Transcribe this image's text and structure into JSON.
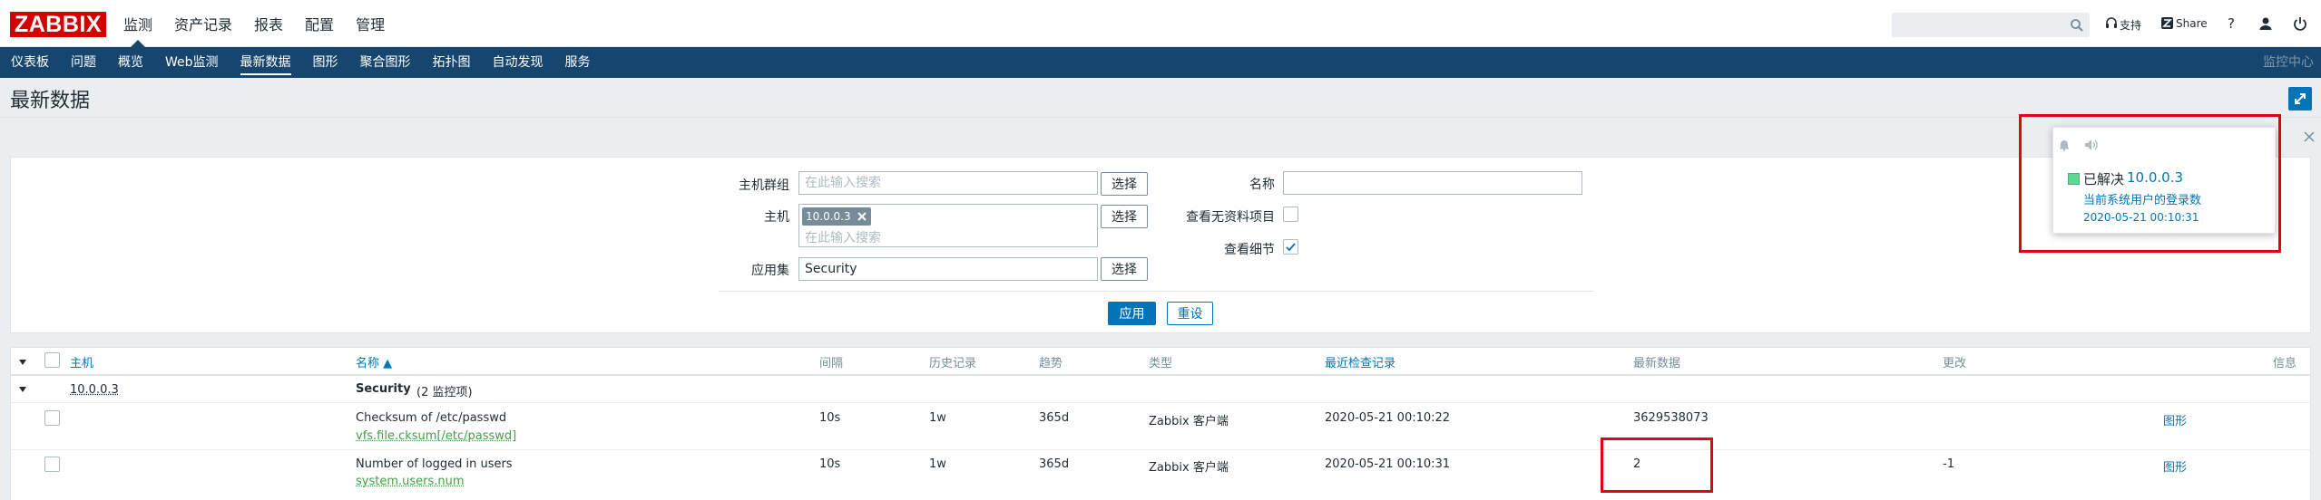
{
  "header": {
    "logo": "ZABBIX",
    "menu": [
      {
        "label": "监测",
        "selected": true
      },
      {
        "label": "资产记录",
        "selected": false
      },
      {
        "label": "报表",
        "selected": false
      },
      {
        "label": "配置",
        "selected": false
      },
      {
        "label": "管理",
        "selected": false
      }
    ],
    "search_value": "",
    "support_label": "支持",
    "share_label": "Share",
    "help_label": "?"
  },
  "subnav": {
    "items": [
      {
        "label": "仪表板",
        "selected": false
      },
      {
        "label": "问题",
        "selected": false
      },
      {
        "label": "概览",
        "selected": false
      },
      {
        "label": "Web监测",
        "selected": false
      },
      {
        "label": "最新数据",
        "selected": true
      },
      {
        "label": "图形",
        "selected": false
      },
      {
        "label": "聚合图形",
        "selected": false
      },
      {
        "label": "拓扑图",
        "selected": false
      },
      {
        "label": "自动发现",
        "selected": false
      },
      {
        "label": "服务",
        "selected": false
      }
    ],
    "right_label": "监控中心"
  },
  "page": {
    "title": "最新数据"
  },
  "filter": {
    "host_group_label": "主机群组",
    "host_group_placeholder": "在此输入搜索",
    "select_label": "选择",
    "host_label": "主机",
    "host_chip": "10.0.0.3",
    "host_placeholder": "在此输入搜索",
    "application_label": "应用集",
    "application_value": "Security",
    "name_label": "名称",
    "name_value": "",
    "show_without_data_label": "查看无资料项目",
    "show_without_data_checked": false,
    "show_details_label": "查看细节",
    "show_details_checked": true,
    "apply_label": "应用",
    "reset_label": "重设"
  },
  "table": {
    "headers": {
      "host": "主机",
      "name": "名称 ▲",
      "interval": "间隔",
      "history": "历史记录",
      "trends": "趋势",
      "type": "类型",
      "last_check": "最近检查记录",
      "last_value": "最新数据",
      "change": "更改",
      "info": "信息"
    },
    "group": {
      "host": "10.0.0.3",
      "app": "Security",
      "count": "(2 监控项)"
    },
    "rows": [
      {
        "name": "Checksum of /etc/passwd",
        "key": "vfs.file.cksum[/etc/passwd]",
        "interval": "10s",
        "history": "1w",
        "trends": "365d",
        "type": "Zabbix 客户端",
        "last_check": "2020-05-21 00:10:22",
        "last_value": "3629538073",
        "change": "",
        "graph": "图形"
      },
      {
        "name": "Number of logged in users",
        "key": "system.users.num",
        "interval": "10s",
        "history": "1w",
        "trends": "365d",
        "type": "Zabbix 客户端",
        "last_check": "2020-05-21 00:10:31",
        "last_value": "2",
        "change": "-1",
        "graph": "图形"
      }
    ]
  },
  "notification": {
    "status": "已解决",
    "host": "10.0.0.3",
    "message": "当前系统用户的登录数",
    "time": "2020-05-21 00:10:31",
    "status_color": "#59db8f"
  },
  "colors": {
    "accent": "#0275b8",
    "nav": "#16456e",
    "highlight": "#e0000f",
    "logo": "#d40000"
  }
}
